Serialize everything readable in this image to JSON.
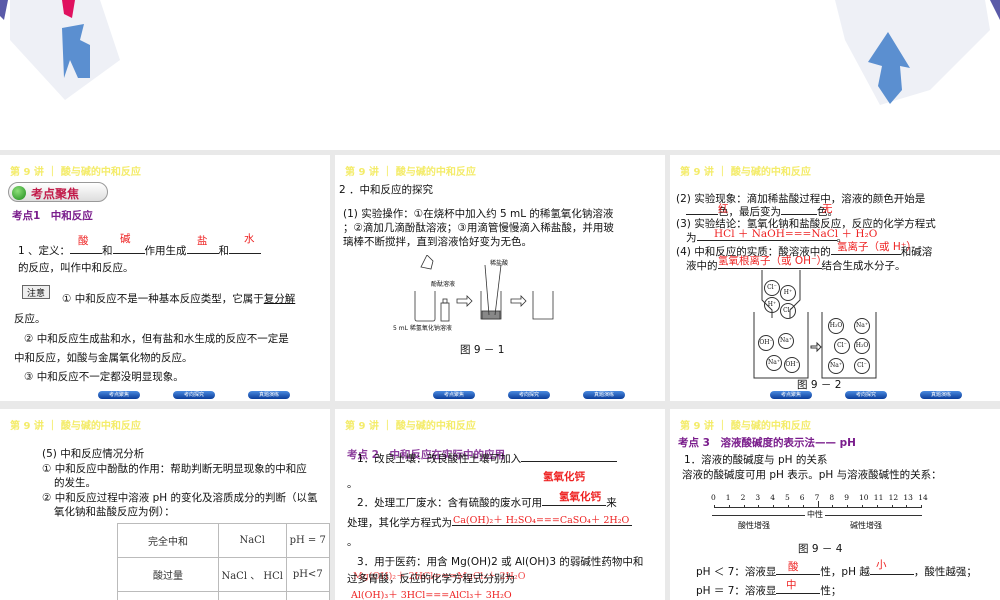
{
  "header": "第 9 讲 ｜ 酸与碱的中和反应",
  "nav": [
    "考点聚焦",
    "考向探究",
    "真题演练"
  ],
  "slide1": {
    "badge": "考点聚焦",
    "section": "考点1　中和反应",
    "def_prefix": "1 、定义：",
    "and1": "和",
    "mid": "作用生成",
    "and2": "和",
    "def_end": "的反应，叫作中和反应。",
    "answers": [
      "酸",
      "碱",
      "盐",
      "水"
    ],
    "note_label": "注意",
    "note1a": "① 中和反应不是一种基本反应类型，它属于",
    "note1u": "复分解",
    "note1b": "反应。",
    "note2a": "② 中和反应生成盐和水，但有盐和水生成的反应不一定是",
    "note2b": "中和反应，如酸与金属氧化物的反应。",
    "note3": "③ 中和反应不一定都没明显现象。"
  },
  "slide2": {
    "title": "2 ．中和反应的探究",
    "op1": "(1) 实验操作：①在烧杯中加入约 5 mL 的稀氢氧化钠溶液",
    "op2": "；②滴加几滴酚酞溶液；③用滴管慢慢滴入稀盐酸，并用玻",
    "op3": "璃棒不断搅拌，直到溶液恰好变为无色。",
    "label_acid": "稀盐酸",
    "label_phenol": "酚酞溶液",
    "label_naoh": "5 mL 稀氢氧化钠溶液",
    "caption": "图 9 － 1"
  },
  "slide3": {
    "l1": "(2) 实验现象：滴加稀盐酸过程中，溶液的颜色开始是",
    "l2a": "色，最后变为",
    "l2b": "色。",
    "a_red": "红",
    "a_none": "无",
    "l3": "(3) 实验结论：氢氧化钠和盐酸反应，反应的化学方程式",
    "l4": "为",
    "l4end": "。",
    "eq": "HCl ＋ NaOH===NaCl ＋ H₂O",
    "l5a": "(4) 中和反应的实质：酸溶液中的",
    "l5b": "和碱溶",
    "l6a": "液中的",
    "l6b": "结合生成水分子。",
    "a_h": "氢离子（或 H⁺）",
    "a_oh": "氢氧根离子（或 OH⁻）",
    "ions_top": [
      "Cl⁻",
      "H⁺",
      "H⁺",
      "Cl⁻"
    ],
    "ions_left": [
      "OH⁻",
      "Na⁺",
      "Na⁺",
      "OH⁻"
    ],
    "ions_right": [
      "H₂O",
      "Na⁺",
      "Cl⁻",
      "H₂O",
      "Na⁺",
      "Cl⁻"
    ],
    "caption": "图 9 － 2"
  },
  "slide4": {
    "l1": "(5) 中和反应情况分析",
    "l2": "① 中和反应中酚酞的作用：帮助判断无明显现象的中和应",
    "l3": "的发生。",
    "l4": "② 中和反应过程中溶液 pH 的变化及溶质成分的判断（以氢",
    "l5": "氧化钠和盐酸反应为例）：",
    "table": [
      [
        "完全中和",
        "NaCl",
        "pH = 7"
      ],
      [
        "酸过量",
        "NaCl 、 HCl",
        "pH<7"
      ]
    ]
  },
  "slide5": {
    "section": "考点 2　中和反应在实际中的应用",
    "l1": "1．改良土壤：改良酸性土壤可加入",
    "a1": "氢氧化钙",
    "dot": "。",
    "l2a": "2．处理工厂废水：含有硫酸的废水可用",
    "l2b": "来",
    "a2": "氢氧化钙",
    "l3": "处理，其化学方程式为",
    "eq1": "Ca(OH)₂＋ H₂SO₄===CaSO₄＋ 2H₂O",
    "l4": "3．用于医药：用含 Mg(OH)2 或 Al(OH)3 的弱碱性药物中和",
    "l5": "过多胃酸，反应的化学方程式分别为",
    "eq2": "Mg(OH)₂＋ 2HCl===MgCl₂＋ 2H₂O",
    "eq3": "Al(OH)₃＋ 3HCl===AlCl₃＋ 3H₂O"
  },
  "slide6": {
    "section": "考点 3　溶液酸碱度的表示法—— pH",
    "l1": "1．溶液的酸碱度与 pH 的关系",
    "l2": "溶液的酸碱度可用 pH 表示。pH 与溶液酸碱性的关系：",
    "ticks": [
      "0",
      "1",
      "2",
      "3",
      "4",
      "5",
      "6",
      "7",
      "8",
      "9",
      "10",
      "11",
      "12",
      "13",
      "14"
    ],
    "neutral": "中性",
    "acid": "酸性增强",
    "base": "碱性增强",
    "caption": "图 9 － 4",
    "r1a": "pH ＜ 7：溶液显",
    "r1b": "性，pH 越",
    "r1c": "，酸性越强；",
    "a_acid": "酸",
    "a_small": "小",
    "r2a": "pH ＝ 7：溶液显",
    "r2b": "性；",
    "a_mid": "中"
  }
}
